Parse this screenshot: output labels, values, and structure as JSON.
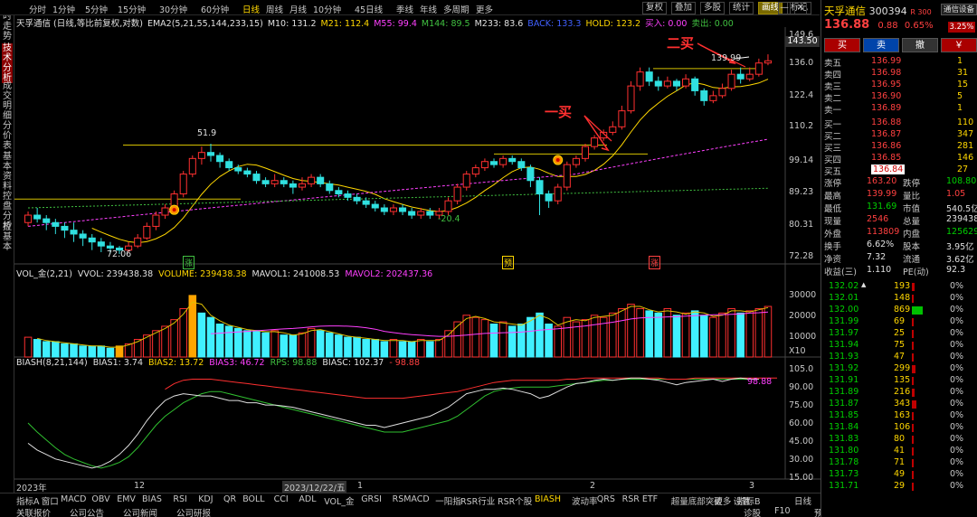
{
  "app": {
    "stock_name": "天孚通信",
    "stock_code": "300394",
    "badge": "R 300",
    "notify_btn": "通信设备",
    "notify_pct": "3.25%"
  },
  "timeframes": [
    "分时",
    "1分钟",
    "5分钟",
    "15分钟",
    "30分钟",
    "60分钟",
    "日线",
    "周线",
    "月线",
    "10分钟",
    "45日线",
    "季线",
    "年线",
    "多周期",
    "更多"
  ],
  "active_timeframe": "日线",
  "toolbar": [
    "复权",
    "叠加",
    "多股",
    "统计",
    "画线",
    "标记"
  ],
  "left_tabs": [
    "分时走势",
    "技术分析",
    "成交明细",
    "分价表",
    "基本资料",
    "控盘分析",
    "控基本"
  ],
  "main_legend": [
    {
      "t": "天孚通信 (日线,等比前复权,对数)",
      "c": "#e0e0e0"
    },
    {
      "t": "EMA2(5,21,55,144,233,15)",
      "c": "#e0e0e0"
    },
    {
      "t": "M10: 131.2",
      "c": "#e0e0e0"
    },
    {
      "t": "M21: 112.4",
      "c": "#ffd700"
    },
    {
      "t": "M55: 99.4",
      "c": "#ff40ff"
    },
    {
      "t": "M144: 89.5",
      "c": "#40c040"
    },
    {
      "t": "M233: 83.6",
      "c": "#e0e0e0"
    },
    {
      "t": "BACK: 133.3",
      "c": "#4060ff"
    },
    {
      "t": "HOLD: 123.2",
      "c": "#ffd700"
    },
    {
      "t": "买入: 0.00",
      "c": "#ff40ff"
    },
    {
      "t": "卖出: 0.00",
      "c": "#40c040"
    }
  ],
  "price_axis": [
    "149.6",
    "136.0",
    "122.4",
    "110.2",
    "99.14",
    "89.23",
    "80.31",
    "72.28"
  ],
  "price_current": "143.50",
  "annotations": {
    "first_buy": "一买",
    "second_buy": "二买",
    "high_label": "51.9",
    "low_label": "72.06",
    "mid_label": "-20.4",
    "peak_label": "139.99"
  },
  "event_marks": [
    "涨",
    "预",
    "涨"
  ],
  "vol_legend": [
    {
      "t": "VOL_金(2,21)",
      "c": "#e0e0e0"
    },
    {
      "t": "VVOL: 239438.38",
      "c": "#e0e0e0"
    },
    {
      "t": "VOLUME: 239438.38",
      "c": "#ffd700"
    },
    {
      "t": "MAVOL1: 241008.53",
      "c": "#e0e0e0"
    },
    {
      "t": "MAVOL2: 202437.36",
      "c": "#ff40ff"
    }
  ],
  "vol_axis": [
    "30000",
    "20000",
    "10000"
  ],
  "vol_unit": "X10",
  "bias_legend": [
    {
      "t": "BIASH(8,21,144)",
      "c": "#e0e0e0"
    },
    {
      "t": "BIAS1: 3.74",
      "c": "#e0e0e0"
    },
    {
      "t": "BIAS2: 13.72",
      "c": "#ffd700"
    },
    {
      "t": "BIAS3: 46.72",
      "c": "#ff40ff"
    },
    {
      "t": "RPS: 98.88",
      "c": "#40c040"
    },
    {
      "t": "BIASC: 102.37",
      "c": "#e0e0e0"
    },
    {
      "t": "- 98.88",
      "c": "#ff4040"
    }
  ],
  "bias_axis": [
    "105.0",
    "90.00",
    "75.00",
    "60.00",
    "45.00",
    "30.00",
    "15.00"
  ],
  "bias_value": "98.88",
  "date_axis": [
    "2023年",
    "12",
    "2023/12/22/五",
    "1",
    "2",
    "3"
  ],
  "indicator_tabs": [
    "指标A",
    "窗口",
    "MACD",
    "OBV",
    "EMV",
    "BIAS",
    "RSI",
    "KDJ",
    "QR",
    "BOLL",
    "CCI",
    "ADL",
    "VOL_金",
    "GRSI",
    "RSMACD",
    "一阳指",
    "RSR行业",
    "RSR个股",
    "BIASH",
    "波动率",
    "QRS",
    "RSR ETF",
    "超量底部突破",
    "更多",
    "设置"
  ],
  "active_indicator": "BIASH",
  "indicator_right": [
    "指标B",
    "日线"
  ],
  "bottom_links": [
    "关联报价",
    "公司公告",
    "公司新闻",
    "公司研报"
  ],
  "bottom_right": [
    "诊股",
    "F10",
    "预警",
    "笔",
    "价",
    "分",
    "量",
    "短",
    "筹"
  ],
  "quote": {
    "price": "136.88",
    "change": "0.88",
    "pct": "0.65%"
  },
  "trade_btns": [
    "买",
    "卖",
    "撤",
    "￥"
  ],
  "order_book": {
    "sell": [
      {
        "l": "卖五",
        "p": "136.99",
        "v": "1"
      },
      {
        "l": "卖四",
        "p": "136.98",
        "v": "31"
      },
      {
        "l": "卖三",
        "p": "136.95",
        "v": "15"
      },
      {
        "l": "卖二",
        "p": "136.90",
        "v": "5"
      },
      {
        "l": "卖一",
        "p": "136.89",
        "v": "1"
      }
    ],
    "buy": [
      {
        "l": "买一",
        "p": "136.88",
        "v": "110"
      },
      {
        "l": "买二",
        "p": "136.87",
        "v": "347"
      },
      {
        "l": "买三",
        "p": "136.86",
        "v": "281"
      },
      {
        "l": "买四",
        "p": "136.85",
        "v": "146"
      },
      {
        "l": "买五",
        "p": "136.84",
        "v": "27"
      }
    ]
  },
  "stats": [
    [
      {
        "l": "涨停",
        "v": "163.20",
        "c": "up"
      },
      {
        "l": "跌停",
        "v": "108.80",
        "c": "dn"
      }
    ],
    [
      {
        "l": "最高",
        "v": "139.99",
        "c": "up"
      },
      {
        "l": "量比",
        "v": "1.05",
        "c": "up"
      }
    ],
    [
      {
        "l": "最低",
        "v": "131.69",
        "c": "dn"
      },
      {
        "l": "市值",
        "v": "540.5亿",
        "c": "wh"
      }
    ],
    [
      {
        "l": "现量",
        "v": "2546",
        "c": "up"
      },
      {
        "l": "总量",
        "v": "239438",
        "c": "wh"
      }
    ],
    [
      {
        "l": "外盘",
        "v": "113809",
        "c": "up"
      },
      {
        "l": "内盘",
        "v": "125629",
        "c": "dn"
      }
    ],
    [
      {
        "l": "换手",
        "v": "6.62%",
        "c": "wh"
      },
      {
        "l": "股本",
        "v": "3.95亿",
        "c": "wh"
      }
    ],
    [
      {
        "l": "净资",
        "v": "7.32",
        "c": "wh"
      },
      {
        "l": "流通",
        "v": "3.62亿",
        "c": "wh"
      }
    ],
    [
      {
        "l": "收益(三)",
        "v": "1.110",
        "c": "wh"
      },
      {
        "l": "PE(动)",
        "v": "92.3",
        "c": "wh"
      }
    ]
  ],
  "ticks": [
    {
      "p": "132.02",
      "v": "193",
      "m": "▲",
      "pc": "0%"
    },
    {
      "p": "132.01",
      "v": "148",
      "pc": "0%"
    },
    {
      "p": "132.00",
      "v": "869",
      "pc": "0%"
    },
    {
      "p": "131.99",
      "v": "69",
      "pc": "0%"
    },
    {
      "p": "131.97",
      "v": "25",
      "pc": "0%"
    },
    {
      "p": "131.94",
      "v": "75",
      "pc": "0%"
    },
    {
      "p": "131.93",
      "v": "47",
      "pc": "0%"
    },
    {
      "p": "131.92",
      "v": "299",
      "pc": "0%"
    },
    {
      "p": "131.91",
      "v": "135",
      "pc": "0%"
    },
    {
      "p": "131.89",
      "v": "216",
      "pc": "0%"
    },
    {
      "p": "131.87",
      "v": "343",
      "pc": "0%"
    },
    {
      "p": "131.85",
      "v": "163",
      "pc": "0%"
    },
    {
      "p": "131.84",
      "v": "106",
      "pc": "0%"
    },
    {
      "p": "131.83",
      "v": "80",
      "pc": "0%"
    },
    {
      "p": "131.80",
      "v": "41",
      "pc": "0%"
    },
    {
      "p": "131.78",
      "v": "71",
      "pc": "0%"
    },
    {
      "p": "131.73",
      "v": "49",
      "pc": "0%"
    },
    {
      "p": "131.71",
      "v": "29",
      "pc": "0%"
    }
  ],
  "candles": [
    [
      80,
      82,
      79,
      83
    ],
    [
      82,
      81,
      80,
      84
    ],
    [
      81,
      80,
      78,
      82
    ],
    [
      80,
      79,
      77,
      81
    ],
    [
      79,
      78,
      76,
      80
    ],
    [
      78,
      77,
      75,
      80
    ],
    [
      77,
      76,
      74,
      78
    ],
    [
      76,
      75,
      73,
      77
    ],
    [
      75,
      74,
      72.5,
      76
    ],
    [
      74,
      73.5,
      72.2,
      75
    ],
    [
      73.5,
      73,
      72.06,
      74
    ],
    [
      73,
      74,
      72.5,
      75
    ],
    [
      74,
      76,
      73.5,
      77
    ],
    [
      76,
      79,
      75.5,
      80
    ],
    [
      79,
      82,
      78,
      83
    ],
    [
      82,
      84,
      81,
      85
    ],
    [
      84,
      88,
      83,
      89
    ],
    [
      88,
      94,
      87,
      95
    ],
    [
      94,
      99,
      93,
      100
    ],
    [
      99,
      101,
      97,
      103
    ],
    [
      101,
      100,
      98,
      104
    ],
    [
      100,
      98,
      96,
      101
    ],
    [
      98,
      96,
      95,
      99
    ],
    [
      96,
      95,
      94,
      97
    ],
    [
      95,
      94,
      93,
      96
    ],
    [
      94,
      92,
      91,
      95
    ],
    [
      92,
      91,
      90,
      93
    ],
    [
      91,
      92,
      90,
      94
    ],
    [
      92,
      91,
      90,
      93
    ],
    [
      91,
      90,
      88,
      92
    ],
    [
      90,
      91,
      89,
      93
    ],
    [
      91,
      93,
      90,
      94
    ],
    [
      93,
      91,
      90,
      94
    ],
    [
      91,
      89,
      88,
      92
    ],
    [
      89,
      88,
      87,
      90
    ],
    [
      88,
      87,
      86,
      89
    ],
    [
      87,
      86,
      85,
      88
    ],
    [
      86,
      85,
      84,
      87
    ],
    [
      85,
      84,
      83,
      86
    ],
    [
      84,
      83,
      82,
      85
    ],
    [
      83,
      84,
      82,
      85
    ],
    [
      84,
      83,
      82,
      85
    ],
    [
      83,
      82,
      81,
      84
    ],
    [
      82,
      83,
      81,
      84
    ],
    [
      83,
      82,
      81,
      84
    ],
    [
      82,
      83,
      81,
      84
    ],
    [
      83,
      86,
      82,
      87
    ],
    [
      86,
      90,
      85,
      91
    ],
    [
      90,
      94,
      89,
      95
    ],
    [
      94,
      96,
      93,
      97
    ],
    [
      96,
      98,
      95,
      99
    ],
    [
      98,
      97,
      96,
      99
    ],
    [
      97,
      99,
      96,
      100
    ],
    [
      99,
      98,
      97,
      100
    ],
    [
      98,
      96,
      95,
      99
    ],
    [
      96,
      92,
      90,
      97
    ],
    [
      92,
      88,
      82,
      93
    ],
    [
      88,
      86,
      84,
      89
    ],
    [
      86,
      90,
      85,
      91
    ],
    [
      90,
      97,
      89,
      98
    ],
    [
      97,
      99,
      96,
      100
    ],
    [
      99,
      103,
      98,
      104
    ],
    [
      103,
      106,
      102,
      107
    ],
    [
      106,
      108,
      105,
      109
    ],
    [
      108,
      110,
      107,
      112
    ],
    [
      110,
      116,
      109,
      118
    ],
    [
      116,
      126,
      115,
      128
    ],
    [
      126,
      132,
      124,
      134
    ],
    [
      132,
      128,
      126,
      134
    ],
    [
      128,
      126,
      124,
      130
    ],
    [
      126,
      128,
      125,
      130
    ],
    [
      128,
      126,
      124,
      129
    ],
    [
      126,
      129,
      125,
      131
    ],
    [
      129,
      124,
      122,
      130
    ],
    [
      124,
      120,
      118,
      125
    ],
    [
      120,
      122,
      119,
      124
    ],
    [
      122,
      125,
      121,
      127
    ],
    [
      125,
      131,
      124,
      133
    ],
    [
      131,
      129,
      127,
      134
    ],
    [
      129,
      131,
      128,
      134
    ],
    [
      131,
      136,
      130,
      138
    ],
    [
      136,
      137,
      135,
      139.99
    ]
  ],
  "volumes": [
    [
      9,
      1
    ],
    [
      8,
      0
    ],
    [
      7,
      0
    ],
    [
      7,
      0
    ],
    [
      6,
      0
    ],
    [
      6,
      0
    ],
    [
      5,
      0
    ],
    [
      5,
      0
    ],
    [
      5,
      0
    ],
    [
      4,
      0
    ],
    [
      5,
      0
    ],
    [
      6,
      1
    ],
    [
      8,
      1
    ],
    [
      10,
      1
    ],
    [
      12,
      1
    ],
    [
      14,
      1
    ],
    [
      17,
      1
    ],
    [
      22,
      1
    ],
    [
      28,
      1
    ],
    [
      20,
      0
    ],
    [
      18,
      0
    ],
    [
      15,
      0
    ],
    [
      14,
      0
    ],
    [
      13,
      0
    ],
    [
      12,
      0
    ],
    [
      12,
      0
    ],
    [
      11,
      0
    ],
    [
      12,
      1
    ],
    [
      10,
      0
    ],
    [
      10,
      0
    ],
    [
      11,
      1
    ],
    [
      13,
      1
    ],
    [
      12,
      0
    ],
    [
      11,
      0
    ],
    [
      10,
      0
    ],
    [
      9,
      0
    ],
    [
      9,
      0
    ],
    [
      8,
      0
    ],
    [
      8,
      0
    ],
    [
      7,
      0
    ],
    [
      8,
      1
    ],
    [
      7,
      0
    ],
    [
      7,
      0
    ],
    [
      8,
      1
    ],
    [
      7,
      0
    ],
    [
      8,
      1
    ],
    [
      12,
      1
    ],
    [
      16,
      1
    ],
    [
      19,
      1
    ],
    [
      18,
      1
    ],
    [
      17,
      1
    ],
    [
      15,
      0
    ],
    [
      16,
      1
    ],
    [
      14,
      0
    ],
    [
      15,
      0
    ],
    [
      18,
      0
    ],
    [
      20,
      0
    ],
    [
      15,
      0
    ],
    [
      14,
      1
    ],
    [
      18,
      1
    ],
    [
      16,
      1
    ],
    [
      17,
      1
    ],
    [
      19,
      1
    ],
    [
      18,
      1
    ],
    [
      20,
      1
    ],
    [
      22,
      1
    ],
    [
      24,
      1
    ],
    [
      22,
      1
    ],
    [
      21,
      0
    ],
    [
      20,
      0
    ],
    [
      22,
      1
    ],
    [
      19,
      0
    ],
    [
      20,
      1
    ],
    [
      21,
      0
    ],
    [
      19,
      0
    ],
    [
      18,
      1
    ],
    [
      20,
      1
    ],
    [
      22,
      1
    ],
    [
      20,
      0
    ],
    [
      21,
      1
    ],
    [
      22,
      1
    ],
    [
      23,
      1
    ]
  ],
  "bias_white": [
    42,
    36,
    32,
    28,
    26,
    24,
    22,
    20,
    22,
    26,
    32,
    40,
    50,
    62,
    72,
    80,
    84,
    86,
    85,
    84,
    84,
    82,
    80,
    80,
    78,
    78,
    76,
    76,
    75,
    74,
    72,
    70,
    68,
    66,
    64,
    62,
    60,
    58,
    58,
    56,
    58,
    60,
    62,
    64,
    66,
    70,
    74,
    80,
    86,
    88,
    90,
    90,
    91,
    90,
    88,
    86,
    82,
    84,
    88,
    92,
    95,
    96,
    98,
    99,
    98,
    99,
    100,
    100,
    99,
    98,
    96,
    94,
    96,
    97,
    98,
    99,
    97,
    99,
    100,
    99,
    98.88
  ],
  "bias_red": [
    null,
    null,
    null,
    null,
    null,
    null,
    null,
    null,
    null,
    null,
    null,
    null,
    null,
    null,
    null,
    90,
    95,
    98,
    99,
    99,
    99,
    98,
    97,
    96,
    95,
    94,
    93,
    92,
    91,
    90,
    89,
    88,
    87,
    86,
    85,
    84,
    83,
    82,
    82,
    82,
    82,
    82,
    83,
    84,
    85,
    86,
    87,
    88,
    90,
    92,
    94,
    96,
    97,
    98,
    98,
    98,
    98,
    98,
    98,
    99,
    99,
    100,
    100,
    100,
    100,
    100,
    100,
    100,
    100,
    100,
    99,
    99,
    99,
    100,
    100,
    100,
    100,
    100,
    100,
    100,
    100,
    100,
    100
  ],
  "bias_green": [
    60,
    52,
    45,
    38,
    32,
    28,
    25,
    22,
    20,
    22,
    25,
    30,
    38,
    48,
    58,
    66,
    72,
    78,
    82,
    86,
    88,
    88,
    86,
    84,
    82,
    80,
    78,
    76,
    74,
    72,
    70,
    68,
    66,
    64,
    62,
    60,
    58,
    56,
    54,
    52,
    52,
    52,
    54,
    56,
    58,
    60,
    62,
    66,
    72,
    78,
    84,
    88,
    90,
    91,
    92,
    92,
    92,
    92,
    93,
    94,
    95,
    96,
    97,
    98,
    98,
    99,
    99,
    99,
    99,
    99,
    99,
    99,
    99,
    99,
    99,
    99,
    99,
    99,
    99,
    99,
    99
  ]
}
